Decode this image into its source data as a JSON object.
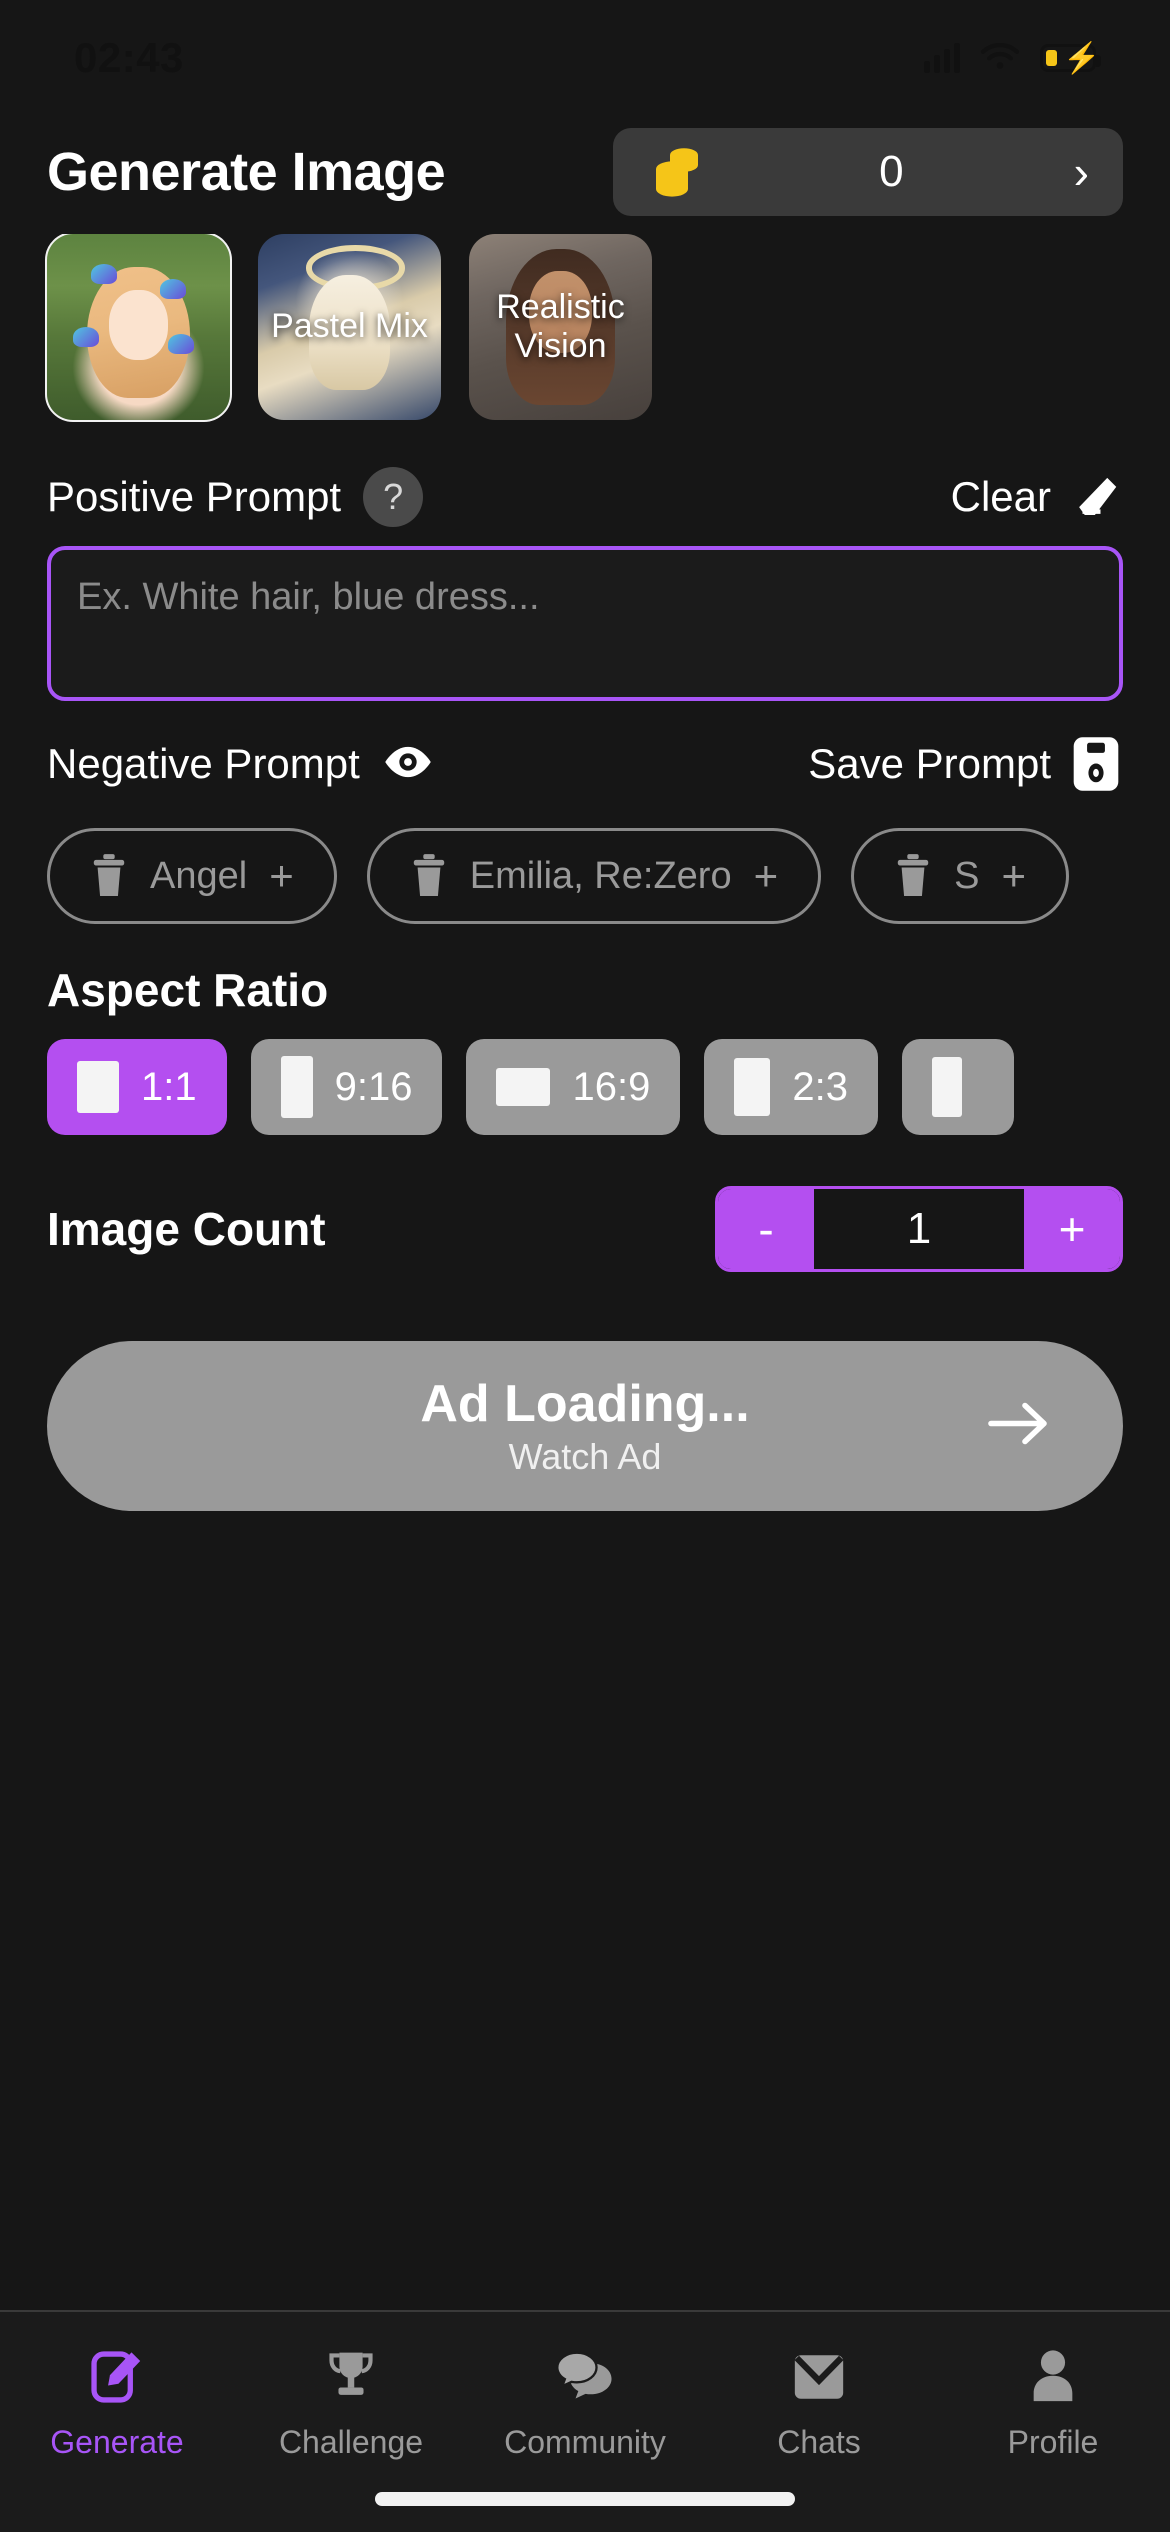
{
  "status_bar": {
    "time": "02:43",
    "signal_icon": "signal-bars-icon",
    "wifi_icon": "wifi-icon",
    "battery_icon": "battery-charging-icon"
  },
  "header": {
    "title": "Generate Image",
    "coin_icon": "coin-stack-icon",
    "coin_balance": "0",
    "chevron": "›"
  },
  "models": [
    {
      "label": "",
      "selected": true,
      "art": "art-anime",
      "name": "anime-butterfly-model"
    },
    {
      "label": "Pastel Mix",
      "selected": false,
      "art": "art-pastel",
      "name": "pastel-mix-model"
    },
    {
      "label": "Realistic Vision",
      "selected": false,
      "art": "art-real",
      "name": "realistic-vision-model"
    }
  ],
  "positive_prompt": {
    "label": "Positive Prompt",
    "help_badge": "?",
    "clear_label": "Clear",
    "clear_icon": "eraser-icon",
    "placeholder": "Ex. White hair, blue dress...",
    "value": ""
  },
  "negative_prompt": {
    "label": "Negative Prompt",
    "eye_icon": "eye-icon",
    "save_label": "Save Prompt",
    "save_icon": "floppy-disk-icon"
  },
  "prompt_chips": [
    {
      "label": "Angel",
      "delete_icon": "trash-icon",
      "add_icon": "plus-icon"
    },
    {
      "label": "Emilia, Re:Zero",
      "delete_icon": "trash-icon",
      "add_icon": "plus-icon"
    },
    {
      "label": "S",
      "delete_icon": "trash-icon",
      "add_icon": "plus-icon"
    }
  ],
  "aspect_ratio": {
    "title": "Aspect Ratio",
    "options": [
      {
        "label": "1:1",
        "selected": true,
        "swatch": "sw-1-1"
      },
      {
        "label": "9:16",
        "selected": false,
        "swatch": "sw-9-16"
      },
      {
        "label": "16:9",
        "selected": false,
        "swatch": "sw-16-9"
      },
      {
        "label": "2:3",
        "selected": false,
        "swatch": "sw-2-3"
      },
      {
        "label": "",
        "selected": false,
        "swatch": "sw-3-2"
      }
    ]
  },
  "image_count": {
    "label": "Image Count",
    "minus": "-",
    "value": "1",
    "plus": "+"
  },
  "cta": {
    "title": "Ad Loading...",
    "subtitle": "Watch Ad",
    "arrow_icon": "arrow-right-icon"
  },
  "tabs": [
    {
      "label": "Generate",
      "icon": "pencil-edit-icon",
      "active": true
    },
    {
      "label": "Challenge",
      "icon": "trophy-icon",
      "active": false
    },
    {
      "label": "Community",
      "icon": "chat-bubbles-icon",
      "active": false
    },
    {
      "label": "Chats",
      "icon": "envelope-icon",
      "active": false
    },
    {
      "label": "Profile",
      "icon": "person-icon",
      "active": false
    }
  ],
  "colors": {
    "accent": "#a855f7",
    "accent_fill": "#b44ff0",
    "background": "#161616",
    "muted": "#9a9a9a",
    "coin": "#f5c518"
  }
}
